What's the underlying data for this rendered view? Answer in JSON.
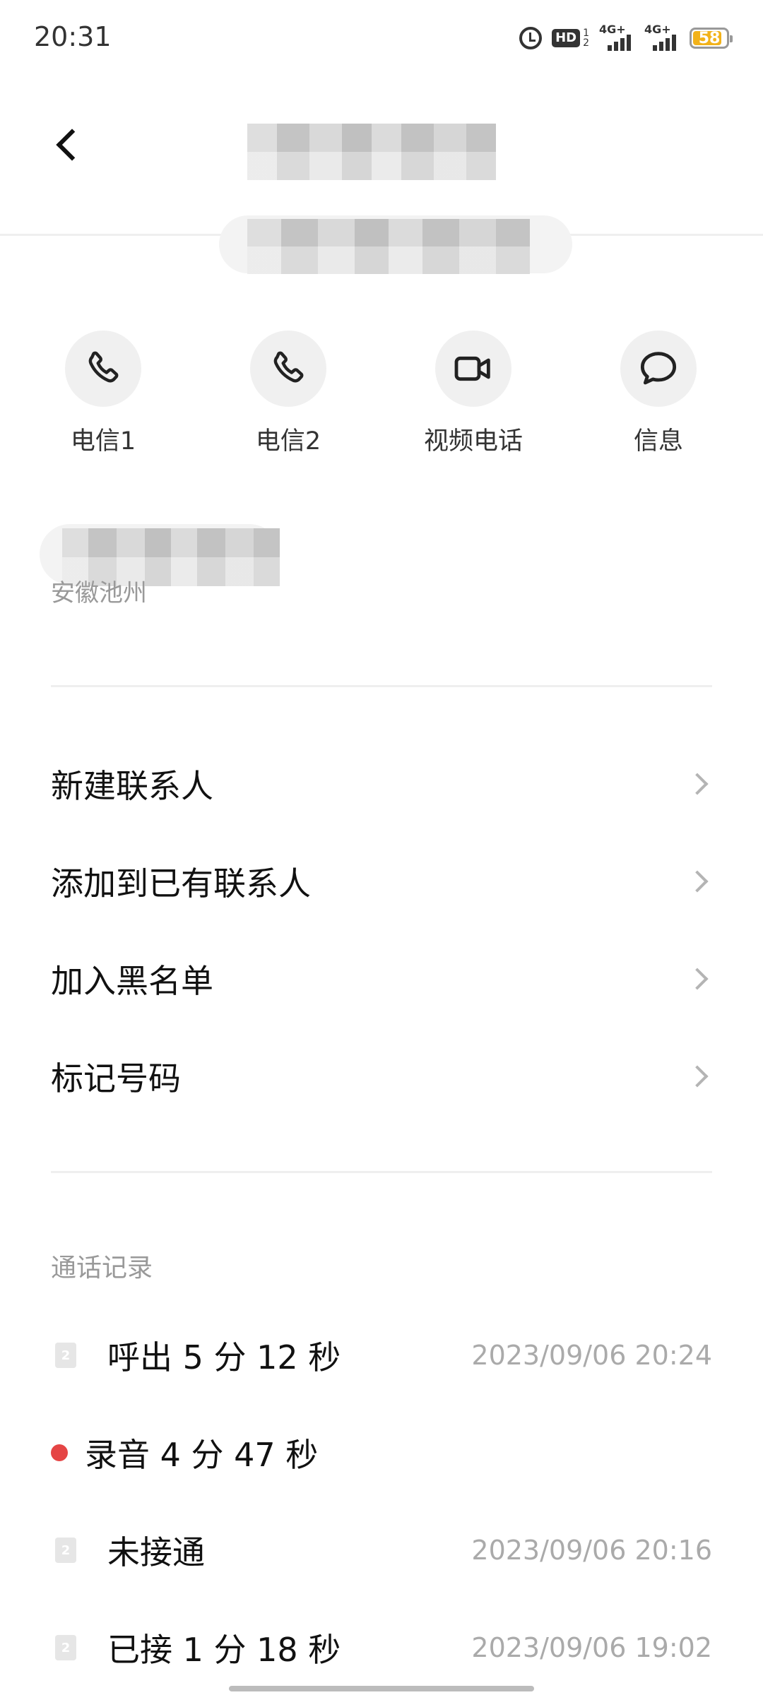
{
  "status_bar": {
    "time": "20:31",
    "hd_label": "HD",
    "hd_sub1": "1",
    "hd_sub2": "2",
    "net1": "4G+",
    "net2": "4G+",
    "battery": "58"
  },
  "header": {
    "back_icon": "chevron-left-icon"
  },
  "actions": [
    {
      "label": "电信1",
      "icon": "phone-icon"
    },
    {
      "label": "电信2",
      "icon": "phone-icon"
    },
    {
      "label": "视频电话",
      "icon": "video-camera-icon"
    },
    {
      "label": "信息",
      "icon": "message-bubble-icon"
    }
  ],
  "location": "安徽池州",
  "menu": [
    {
      "label": "新建联系人"
    },
    {
      "label": "添加到已有联系人"
    },
    {
      "label": "加入黑名单"
    },
    {
      "label": "标记号码"
    }
  ],
  "call_log": {
    "title": "通话记录",
    "entries": [
      {
        "type": "sim",
        "sim": "2",
        "desc": "呼出 5 分 12 秒",
        "date": "2023/09/06  20:24"
      },
      {
        "type": "recording",
        "desc": "录音 4 分 47 秒",
        "date": ""
      },
      {
        "type": "sim",
        "sim": "2",
        "desc": "未接通",
        "date": "2023/09/06  20:16"
      },
      {
        "type": "sim",
        "sim": "2",
        "desc": "已接 1 分 18 秒",
        "date": "2023/09/06  19:02"
      }
    ]
  },
  "colors": {
    "accent_battery": "#f2b21a",
    "recording_dot": "#e54545"
  }
}
